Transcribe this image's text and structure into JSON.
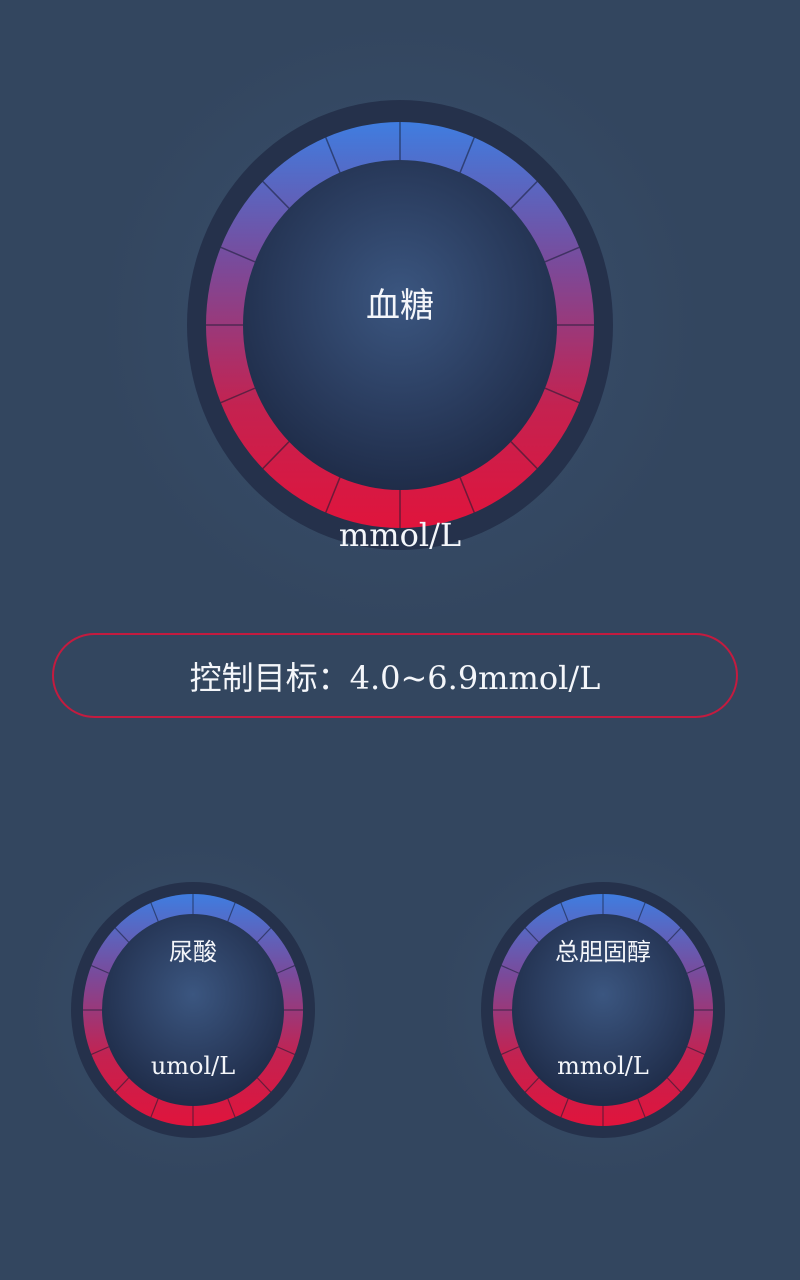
{
  "gauges": {
    "blood_glucose": {
      "title": "血糖",
      "unit": "mmol/L"
    },
    "uric_acid": {
      "title": "尿酸",
      "unit": "umol/L"
    },
    "cholesterol": {
      "title": "总胆固醇",
      "unit": "mmol/L"
    }
  },
  "target": {
    "text": "控制目标：4.0~6.9mmol/L"
  },
  "colors": {
    "background": "#33465f",
    "ring_top": "#3f7de0",
    "ring_bottom": "#e0143c",
    "pill_border": "#c41b3f"
  }
}
